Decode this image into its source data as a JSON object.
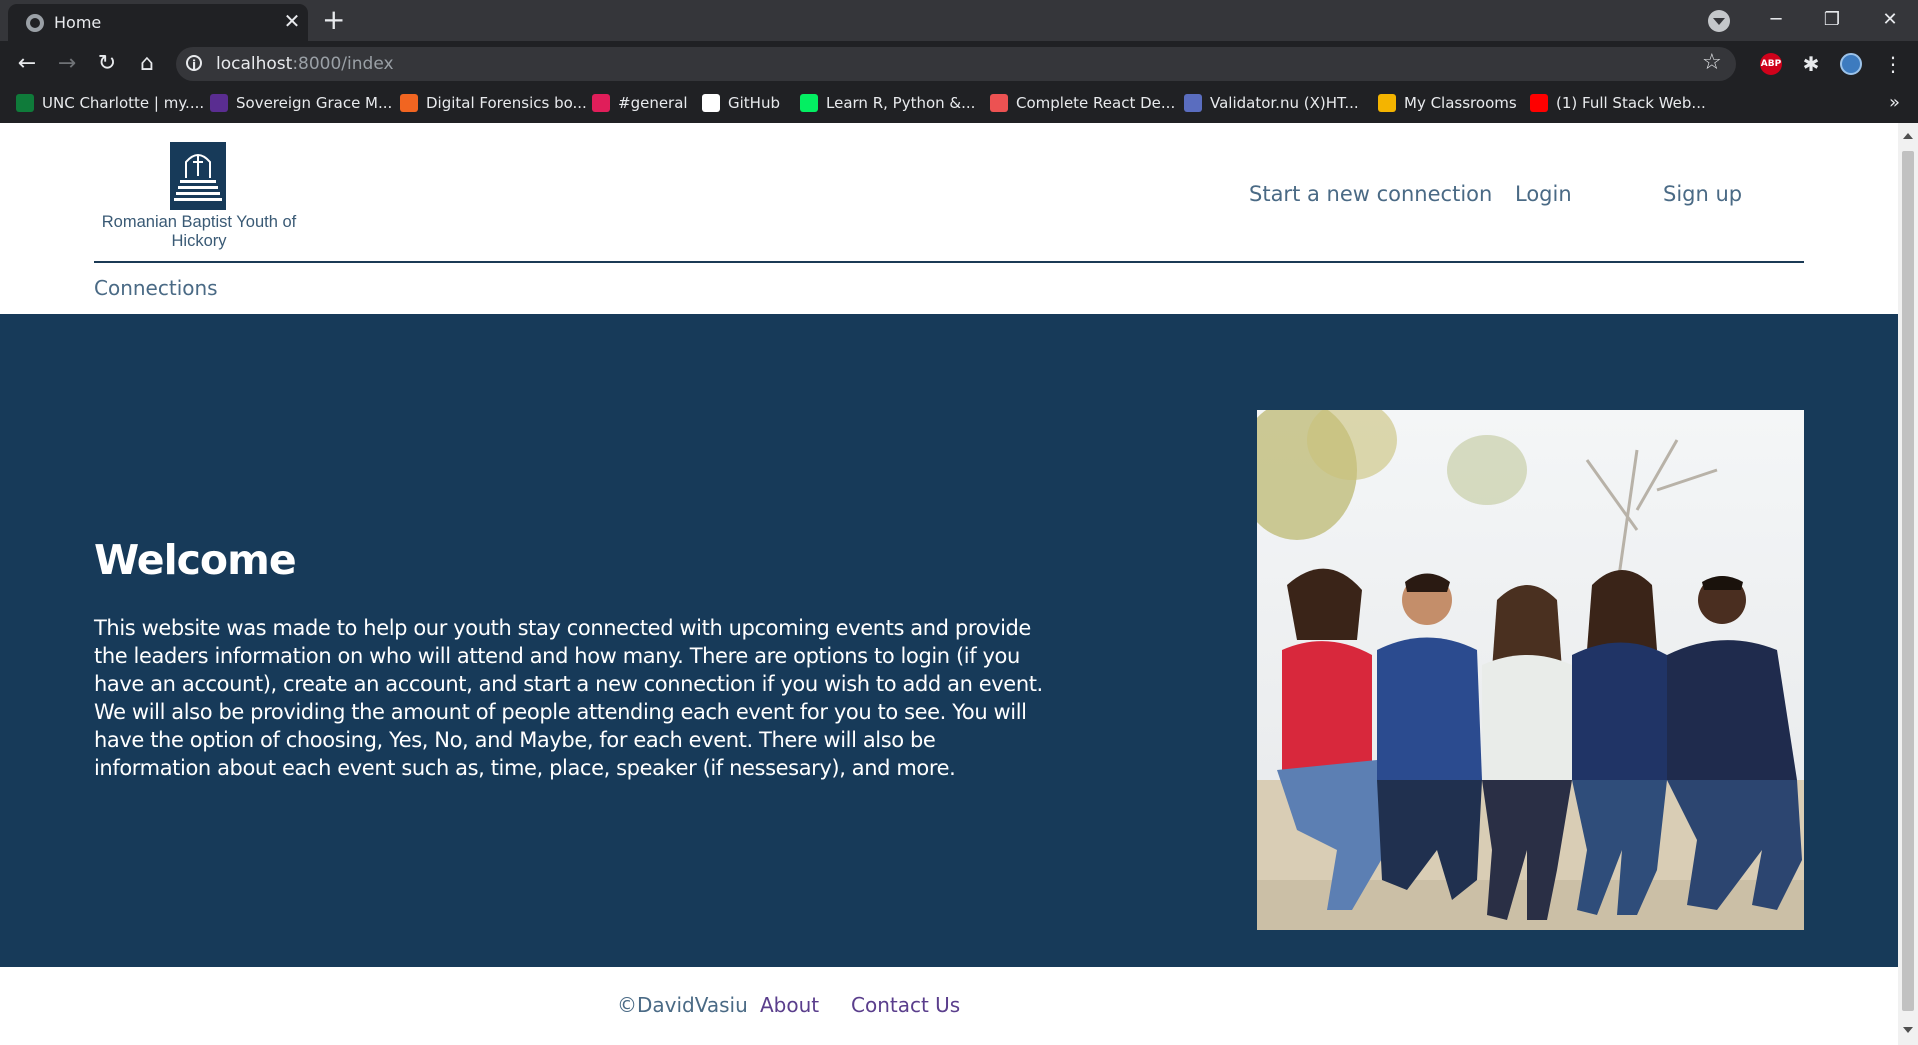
{
  "browser": {
    "tab_title": "Home",
    "tab_close": "✕",
    "new_tab": "+",
    "url_host": "localhost",
    "url_path": ":8000/index",
    "window_controls": {
      "minimize": "─",
      "restore": "❐",
      "close": "✕"
    },
    "extensions": {
      "adblock": "ABP"
    },
    "bookmarks_more": "»",
    "bookmarks": [
      {
        "label": "UNC Charlotte | my....",
        "icon": "unc-icon",
        "color": "#0f7b3a"
      },
      {
        "label": "Sovereign Grace M...",
        "icon": "sovereign-icon",
        "color": "#5a2d91"
      },
      {
        "label": "Digital Forensics bo...",
        "icon": "etsy-icon",
        "color": "#f16521"
      },
      {
        "label": "#general",
        "icon": "slack-icon",
        "color": "#e01e5a"
      },
      {
        "label": "GitHub",
        "icon": "github-icon",
        "color": "#ffffff"
      },
      {
        "label": "Learn R, Python &...",
        "icon": "datacamp-icon",
        "color": "#03ef62"
      },
      {
        "label": "Complete React De...",
        "icon": "udemy-icon",
        "color": "#ec5252"
      },
      {
        "label": "Validator.nu (X)HT...",
        "icon": "validator-icon",
        "color": "#5a6dbf"
      },
      {
        "label": "My Classrooms",
        "icon": "classroom-icon",
        "color": "#f4b400"
      },
      {
        "label": "(1) Full Stack Web...",
        "icon": "youtube-icon",
        "color": "#ff0000"
      }
    ]
  },
  "header": {
    "logo_text": "Romanian Baptist Youth of Hickory",
    "nav": [
      "Start a new connection",
      "Login",
      "Sign up"
    ],
    "subnav": "Connections"
  },
  "hero": {
    "title": "Welcome",
    "body": "This website was made to help our youth stay connected with upcoming events and provide the leaders information on who will attend and how many. There are options to login (if you have an account), create an account, and start a new connection if you wish to add an event. We will also be providing the amount of people attending each event for you to see. You will have the option of choosing, Yes, No, and Maybe, for each event. There will also be information about each event such as, time, place, speaker (if nessesary), and more."
  },
  "footer": {
    "copyright": "©DavidVasiu",
    "about": "About",
    "contact": "Contact Us"
  },
  "colors": {
    "brand_navy": "#173a59",
    "link": "#4a6a85",
    "footer_link": "#5a3e8c"
  }
}
